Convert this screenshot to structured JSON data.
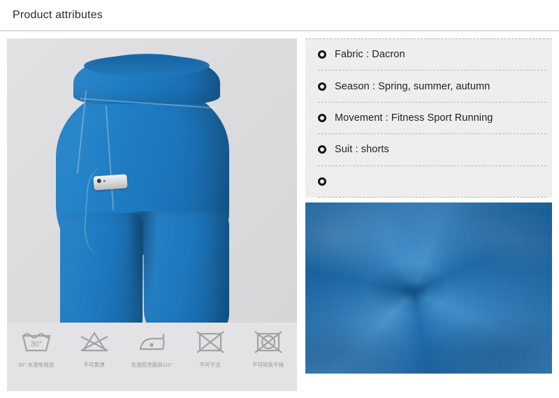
{
  "header": {
    "title": "Product attributes"
  },
  "product_image": {
    "alt": "blue compression shorts with side phone pocket",
    "phone_icon": "smartphone-icon"
  },
  "attributes": [
    {
      "bullet": "ring-bullet-icon",
      "text": "Fabric : Dacron"
    },
    {
      "bullet": "ring-bullet-icon",
      "text": "Season : Spring, summer, autumn"
    },
    {
      "bullet": "ring-bullet-icon",
      "text": "Movement : Fitness Sport Running"
    },
    {
      "bullet": "ring-bullet-icon",
      "text": "Suit : shorts"
    },
    {
      "bullet": "ring-bullet-icon",
      "text": ""
    }
  ],
  "care_instructions": [
    {
      "icon": "wash-tub-30-icon",
      "temp": "30°",
      "label": "30° 水温常规洗"
    },
    {
      "icon": "no-bleach-icon",
      "temp": "",
      "label": "不可氯漂"
    },
    {
      "icon": "low-iron-icon",
      "temp": "",
      "label": "低温熨烫最高110°"
    },
    {
      "icon": "no-dry-clean-icon",
      "temp": "",
      "label": "不可干洗"
    },
    {
      "icon": "no-tumble-dry-icon",
      "temp": "",
      "label": "不可转笼干燥"
    }
  ],
  "fabric_swatch": {
    "alt": "blue knit fabric swirl close-up"
  },
  "colors": {
    "product_blue": "#2180c6",
    "photo_background": "#dcdcde",
    "panel_background": "#ebebeb",
    "care_strip_background": "#e3e3e5",
    "text": "#1f1f1f",
    "care_label": "#9a9a9c",
    "divider": "#dcdcdc"
  }
}
